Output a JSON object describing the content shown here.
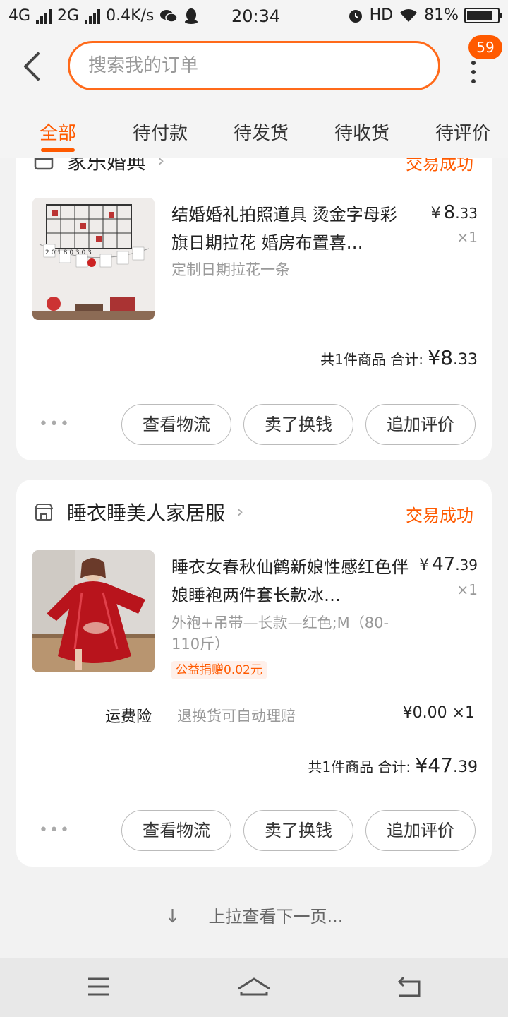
{
  "status_bar": {
    "network1": "4G",
    "network2": "2G",
    "speed": "0.4K/s",
    "time": "20:34",
    "hd": "HD",
    "battery": "81%"
  },
  "header": {
    "search_placeholder": "搜索我的订单",
    "badge": "59"
  },
  "tabs": [
    "全部",
    "待付款",
    "待发货",
    "待收货",
    "待评价"
  ],
  "orders": [
    {
      "shop": "家乐婚典",
      "status": "交易成功",
      "title": "结婚婚礼拍照道具 烫金字母彩旗日期拉花 婚房布置喜…",
      "spec": "定制日期拉花一条",
      "price_yen": "¥",
      "price_int": "8",
      "price_dec": ".33",
      "qty": "×1",
      "total_prefix": "共1件商品 合计:",
      "total_yen": "¥",
      "total_int": "8",
      "total_dec": ".33",
      "thumb_text": "2018 03 03"
    },
    {
      "shop": "睡衣睡美人家居服",
      "status": "交易成功",
      "title": "睡衣女春秋仙鹤新娘性感红色伴娘睡袍两件套长款冰…",
      "spec": "外袍+吊带—长款—红色;M（80-110斤）",
      "charity": "公益捐赠0.02元",
      "price_yen": "¥",
      "price_int": "47",
      "price_dec": ".39",
      "qty": "×1",
      "insurance_label": "运费险",
      "insurance_desc": "退换货可自动理赔",
      "insurance_price": "¥0.00 ×1",
      "total_prefix": "共1件商品 合计:",
      "total_yen": "¥",
      "total_int": "47",
      "total_dec": ".39"
    }
  ],
  "actions": {
    "more_dots": "•••",
    "logistics": "查看物流",
    "resell": "卖了换钱",
    "review": "追加评价"
  },
  "load_more": "上拉查看下一页...",
  "colors": {
    "accent": "#ff5a00",
    "background": "#f2f2f2"
  }
}
